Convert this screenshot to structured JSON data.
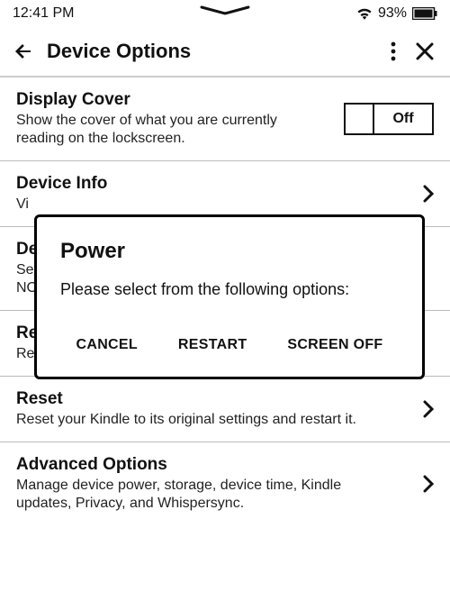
{
  "status": {
    "time": "12:41 PM",
    "battery_pct": "93%"
  },
  "header": {
    "title": "Device Options"
  },
  "items": {
    "display_cover": {
      "title": "Display Cover",
      "desc": "Show the cover of what you are currently reading on the lockscreen.",
      "toggle_label": "Off",
      "toggle_on": false
    },
    "device_info": {
      "title": "Device Info",
      "desc": "Vi"
    },
    "device_passcode": {
      "title": "De",
      "desc_l1": "Se",
      "desc_l2": "NO"
    },
    "restart": {
      "title": "Re",
      "desc": "Re"
    },
    "reset": {
      "title": "Reset",
      "desc": "Reset your Kindle to its original settings and restart it."
    },
    "advanced": {
      "title": "Advanced Options",
      "desc": "Manage device power, storage, device time, Kindle updates, Privacy, and Whispersync."
    }
  },
  "dialog": {
    "title": "Power",
    "message": "Please select from the following options:",
    "buttons": {
      "cancel": "CANCEL",
      "restart": "RESTART",
      "screen_off": "SCREEN OFF"
    }
  }
}
